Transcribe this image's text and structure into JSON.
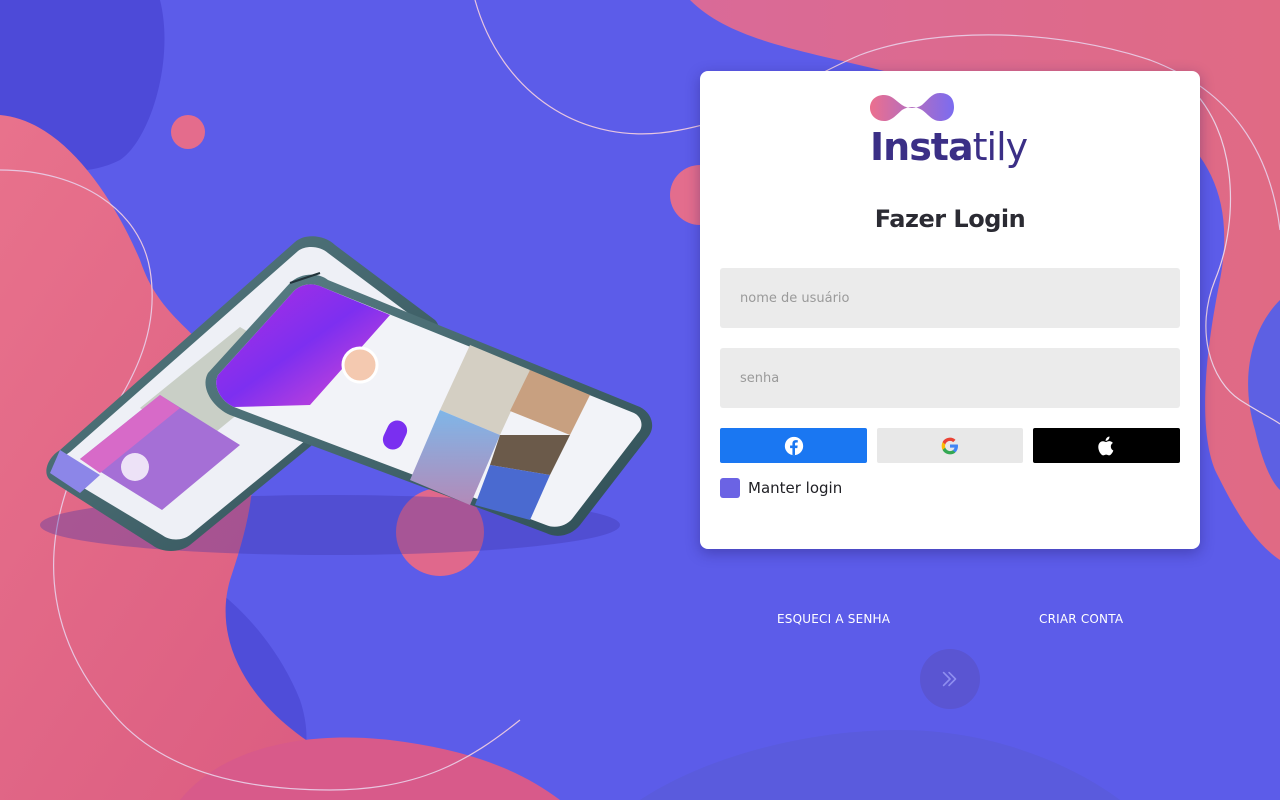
{
  "brand": {
    "name_bold": "Insta",
    "name_light": "tily"
  },
  "login": {
    "title": "Fazer Login",
    "username_placeholder": "nome de usuário",
    "password_placeholder": "senha",
    "keep_login_label": "Manter login",
    "keep_login_checked": true
  },
  "social": {
    "facebook_icon": "facebook-icon",
    "google_icon": "google-icon",
    "apple_icon": "apple-icon"
  },
  "links": {
    "forgot_password": "ESQUECI A SENHA",
    "create_account": "CRIAR CONTA"
  },
  "submit_icon": "double-chevron-right-icon",
  "colors": {
    "background": "#5b5ce8",
    "accent_pink": "#e46a8f",
    "accent_purple": "#6b63e4",
    "facebook": "#1a77f2",
    "apple": "#000000",
    "brand_text": "#3b2f86"
  }
}
